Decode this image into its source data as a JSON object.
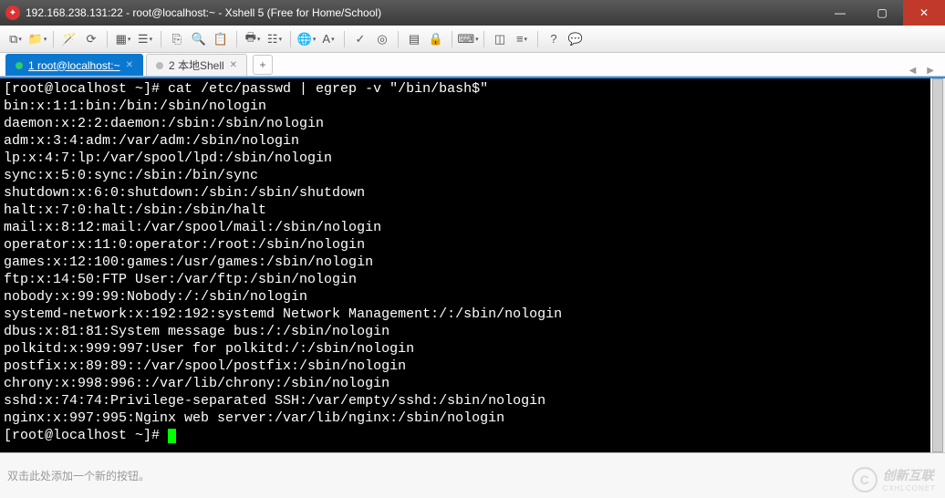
{
  "window": {
    "title": "192.168.238.131:22 - root@localhost:~ - Xshell 5 (Free for Home/School)"
  },
  "tabs": {
    "active": {
      "label": "1 root@localhost:~"
    },
    "second": {
      "label": "2 本地Shell"
    },
    "add": "+"
  },
  "terminal": {
    "prompt1": "[root@localhost ~]# cat /etc/passwd | egrep -v \"/bin/bash$\"",
    "lines": [
      "bin:x:1:1:bin:/bin:/sbin/nologin",
      "daemon:x:2:2:daemon:/sbin:/sbin/nologin",
      "adm:x:3:4:adm:/var/adm:/sbin/nologin",
      "lp:x:4:7:lp:/var/spool/lpd:/sbin/nologin",
      "sync:x:5:0:sync:/sbin:/bin/sync",
      "shutdown:x:6:0:shutdown:/sbin:/sbin/shutdown",
      "halt:x:7:0:halt:/sbin:/sbin/halt",
      "mail:x:8:12:mail:/var/spool/mail:/sbin/nologin",
      "operator:x:11:0:operator:/root:/sbin/nologin",
      "games:x:12:100:games:/usr/games:/sbin/nologin",
      "ftp:x:14:50:FTP User:/var/ftp:/sbin/nologin",
      "nobody:x:99:99:Nobody:/:/sbin/nologin",
      "systemd-network:x:192:192:systemd Network Management:/:/sbin/nologin",
      "dbus:x:81:81:System message bus:/:/sbin/nologin",
      "polkitd:x:999:997:User for polkitd:/:/sbin/nologin",
      "postfix:x:89:89::/var/spool/postfix:/sbin/nologin",
      "chrony:x:998:996::/var/lib/chrony:/sbin/nologin",
      "sshd:x:74:74:Privilege-separated SSH:/var/empty/sshd:/sbin/nologin",
      "nginx:x:997:995:Nginx web server:/var/lib/nginx:/sbin/nologin"
    ],
    "prompt2": "[root@localhost ~]# "
  },
  "status": {
    "hint": "双击此处添加一个新的按钮。"
  },
  "watermark": {
    "brand": "创新互联",
    "sub": "CXHLCONET"
  },
  "icons": {
    "newtab": "⧉",
    "folder": "📁",
    "wand": "🪄",
    "refresh": "⟳",
    "cards": "▦",
    "tree": "☰",
    "copy": "⎘",
    "find": "🔍",
    "clipboard": "📋",
    "print": "🖶",
    "props": "☷",
    "globe": "🌐",
    "font": "A",
    "check": "✓",
    "target": "◎",
    "grid": "▤",
    "lock": "🔒",
    "keyboard": "⌨",
    "layout": "◫",
    "menu": "≡",
    "help": "?",
    "chat": "💬"
  }
}
